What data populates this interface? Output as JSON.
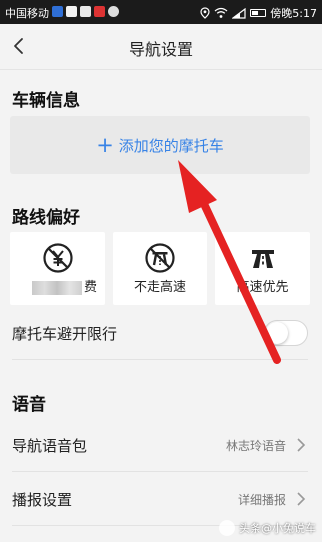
{
  "status_bar": {
    "carrier": "中国移动",
    "time": "傍晚5:17",
    "icons": [
      "location-icon",
      "wifi-icon",
      "signal-icon",
      "battery-icon"
    ]
  },
  "header": {
    "title": "导航设置",
    "back_icon": "chevron-left-icon"
  },
  "vehicle_section": {
    "title": "车辆信息",
    "add_button_label": "添加您的摩托车",
    "add_icon": "plus-icon",
    "accent_color": "#3883e6"
  },
  "route_section": {
    "title": "路线偏好",
    "options": [
      {
        "label": "费",
        "icon": "no-toll-icon",
        "label_obscured": true
      },
      {
        "label": "不走高速",
        "icon": "no-highway-icon"
      },
      {
        "label": "高速优先",
        "icon": "highway-icon"
      }
    ],
    "avoid_restriction_label": "摩托车避开限行",
    "avoid_restriction_enabled": false
  },
  "voice_section": {
    "title": "语音",
    "rows": [
      {
        "label": "导航语音包",
        "value": "林志玲语音"
      },
      {
        "label": "播报设置",
        "value": "详细播报"
      }
    ]
  },
  "annotation": {
    "arrow_color": "#e52222"
  },
  "watermark": {
    "text": "头条@小兔说车"
  }
}
